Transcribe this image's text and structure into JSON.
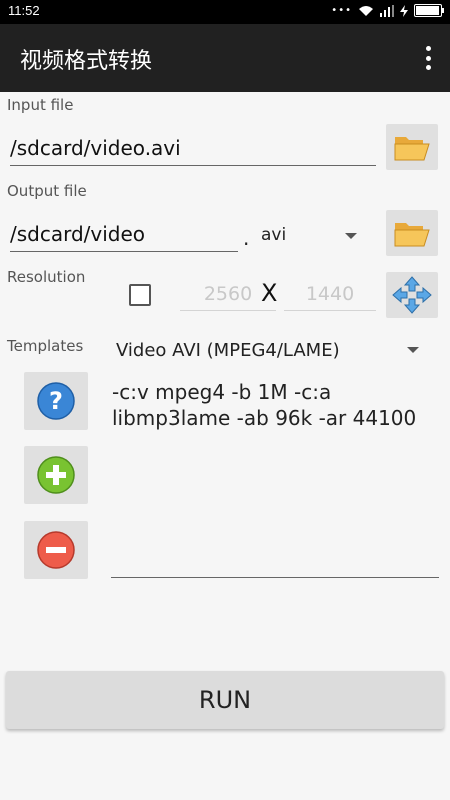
{
  "status_bar": {
    "time": "11:52",
    "battery_level": 0.95
  },
  "app": {
    "title": "视频格式转换"
  },
  "input": {
    "label": "Input file",
    "value": "/sdcard/video.avi"
  },
  "output": {
    "label": "Output file",
    "value": "/sdcard/video",
    "dot": ".",
    "format": "avi"
  },
  "resolution": {
    "label": "Resolution",
    "width_hint": "2560",
    "separator": "X",
    "height_hint": "1440",
    "checked": false
  },
  "templates": {
    "label": "Templates",
    "selected": "Video AVI (MPEG4/LAME)"
  },
  "command": {
    "text": "-c:v mpeg4 -b 1M -c:a libmp3lame -ab 96k -ar 44100"
  },
  "run_button": {
    "label": "RUN"
  },
  "icons": {
    "folder": "folder-icon",
    "expand": "expand-arrows-icon",
    "help": "help-icon",
    "add": "add-icon",
    "remove": "remove-icon"
  }
}
